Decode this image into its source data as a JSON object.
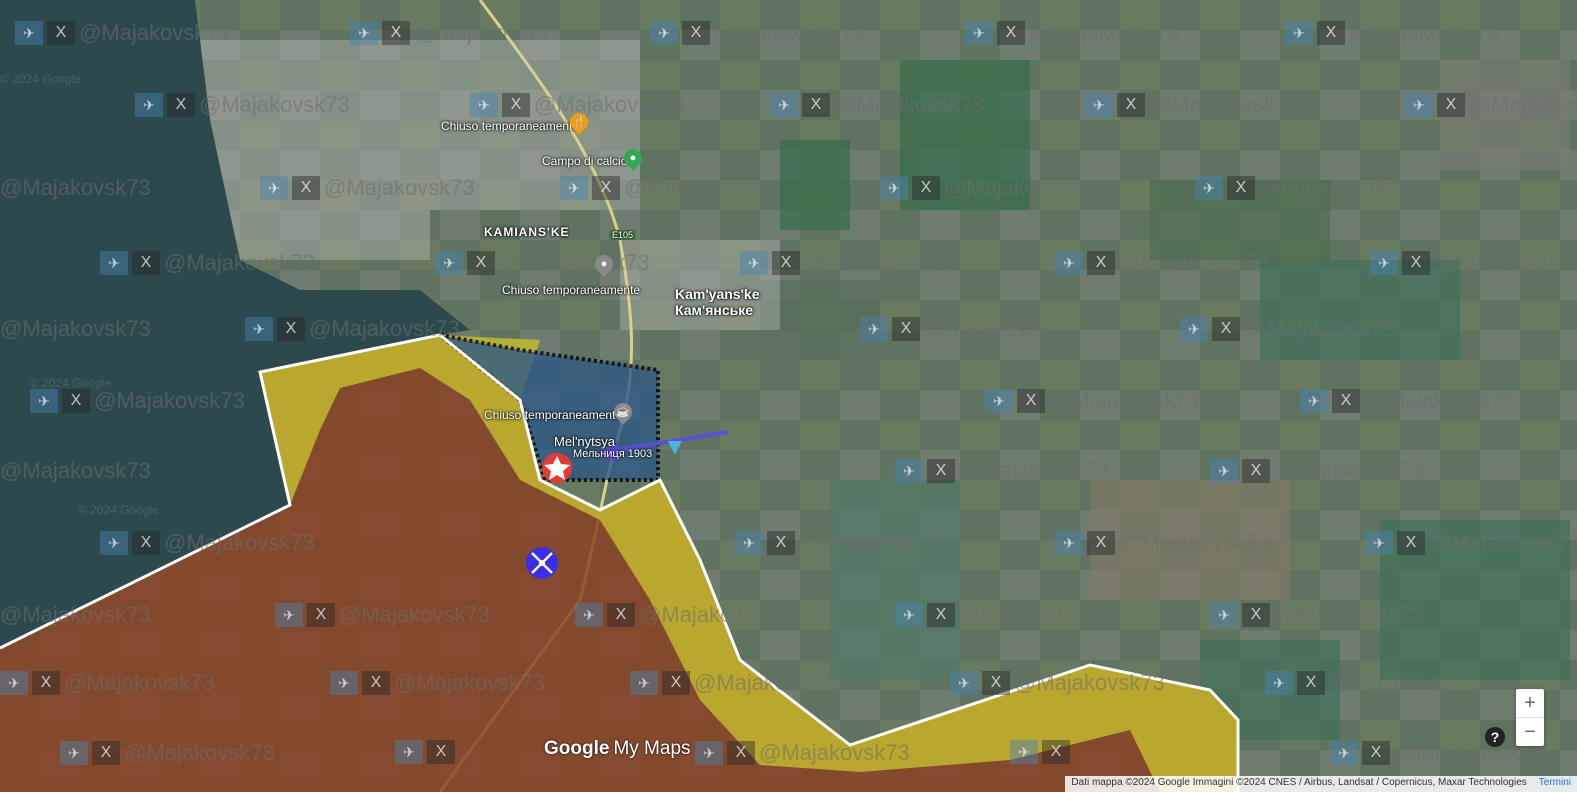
{
  "map": {
    "labels": {
      "town_latin": "Kam'yans'ke",
      "town_cyrillic": "Кам'янське",
      "district": "KAMIANS'KE",
      "road": "E105",
      "closed_1": "Chiuso temporaneamente",
      "closed_2": "Chiuso temporaneamente",
      "closed_3": "Chiuso temporaneamente",
      "football": "Campo di calcio",
      "mill": "Mel'nytsya",
      "mill_year": "Мельниця 1903"
    },
    "watermark": "@Majakovsk73",
    "watermark_copyright": "© 2024 Google",
    "colors": {
      "water": "#2c4a4e",
      "russian_area": "#8a3f22",
      "contested": "#c9c12e",
      "ua_advance": "#2f5a86",
      "frontline": "#ffffff",
      "arrow": "#5a4fd8"
    }
  },
  "logo": {
    "google": "Google",
    "mymaps": "My Maps"
  },
  "controls": {
    "zoom_in": "+",
    "zoom_out": "−",
    "help": "?"
  },
  "attribution": {
    "text": "Dati mappa ©2024 Google Immagini ©2024 CNES / Airbus, Landsat / Copernicus, Maxar Technologies",
    "terms": "Termini"
  },
  "icons": {
    "explosion": "explosion-icon",
    "drone": "drone-icon",
    "restaurant": "restaurant-pin-icon",
    "place": "place-pin-icon",
    "football": "football-pin-icon"
  }
}
